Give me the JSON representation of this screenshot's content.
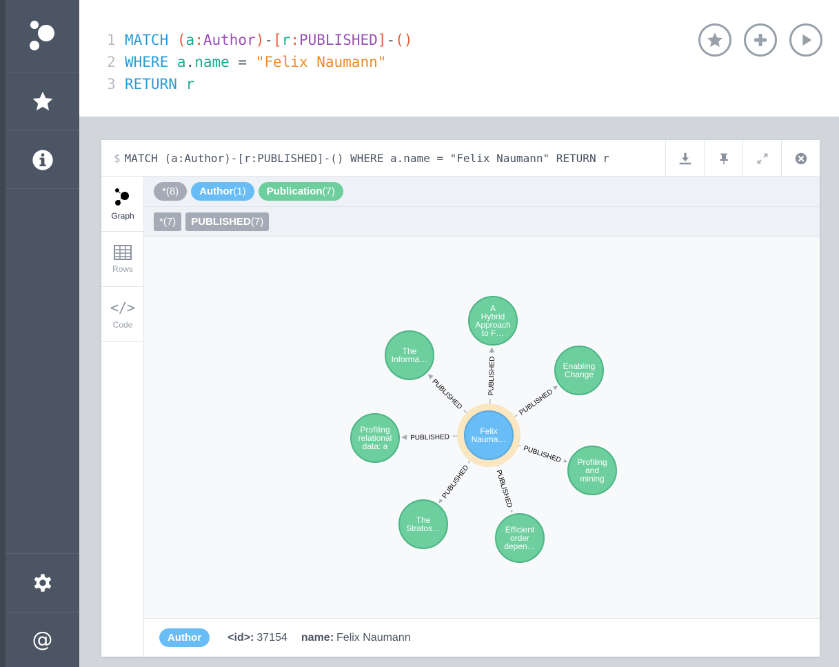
{
  "sidebar": {
    "items": [
      {
        "icon": "neo4j-logo-icon"
      },
      {
        "icon": "star-icon"
      },
      {
        "icon": "info-icon"
      }
    ],
    "bottom": [
      {
        "icon": "gear-icon"
      },
      {
        "icon": "at-icon"
      }
    ]
  },
  "editor": {
    "lines": [
      {
        "n": "1"
      },
      {
        "n": "2"
      },
      {
        "n": "3"
      }
    ],
    "line1": {
      "kw": "MATCH",
      "p1": "(",
      "var": "a",
      "colon": ":",
      "label": "Author",
      "p2": ")",
      "dash1": "-",
      "b1": "[",
      "rvar": "r",
      "rcolon": ":",
      "rtype": "PUBLISHED",
      "b2": "]",
      "dash2": "-",
      "p3": "()"
    },
    "line2": {
      "kw": "WHERE",
      "var": "a",
      "dot": ".",
      "prop": "name",
      "eq": "=",
      "str": "\"Felix Naumann\""
    },
    "line3": {
      "kw": "RETURN",
      "var": "r"
    },
    "actions": [
      "favorite-button",
      "add-button",
      "run-button"
    ]
  },
  "frame": {
    "dollar": "$",
    "query": "MATCH (a:Author)-[r:PUBLISHED]-() WHERE a.name = \"Felix Naumann\" RETURN r",
    "tabs": [
      {
        "label": "Graph"
      },
      {
        "label": "Rows"
      },
      {
        "label": "Code"
      }
    ],
    "node_legend": [
      {
        "name": "*",
        "count": "(8)",
        "color": "#a5abb6"
      },
      {
        "name": "Author",
        "count": "(1)",
        "color": "#68bdf6"
      },
      {
        "name": "Publication",
        "count": "(7)",
        "color": "#6dce9e"
      }
    ],
    "rel_legend": [
      {
        "name": "*",
        "count": "(7)"
      },
      {
        "name": "PUBLISHED",
        "count": "(7)"
      }
    ],
    "graph": {
      "center": {
        "lines": [
          "Felix",
          "Nauma…"
        ],
        "color": "#68bdf6"
      },
      "nodes": [
        {
          "lines": [
            "A",
            "Hybrid",
            "Approach",
            "to F…"
          ]
        },
        {
          "lines": [
            "Enabling",
            "Change"
          ]
        },
        {
          "lines": [
            "Profiling",
            "and",
            "mining"
          ]
        },
        {
          "lines": [
            "Efficient",
            "order",
            "depen…"
          ]
        },
        {
          "lines": [
            "The",
            "Stratos…"
          ]
        },
        {
          "lines": [
            "Profiling",
            "relational",
            "data: a"
          ]
        },
        {
          "lines": [
            "The",
            "Informa…"
          ]
        }
      ],
      "edge_label": "PUBLISHED",
      "node_color": "#6dce9e",
      "node_border": "#4cb585"
    },
    "status": {
      "label": "Author",
      "id_key": "<id>:",
      "id_val": "37154",
      "name_key": "name:",
      "name_val": "Felix Naumann"
    }
  }
}
